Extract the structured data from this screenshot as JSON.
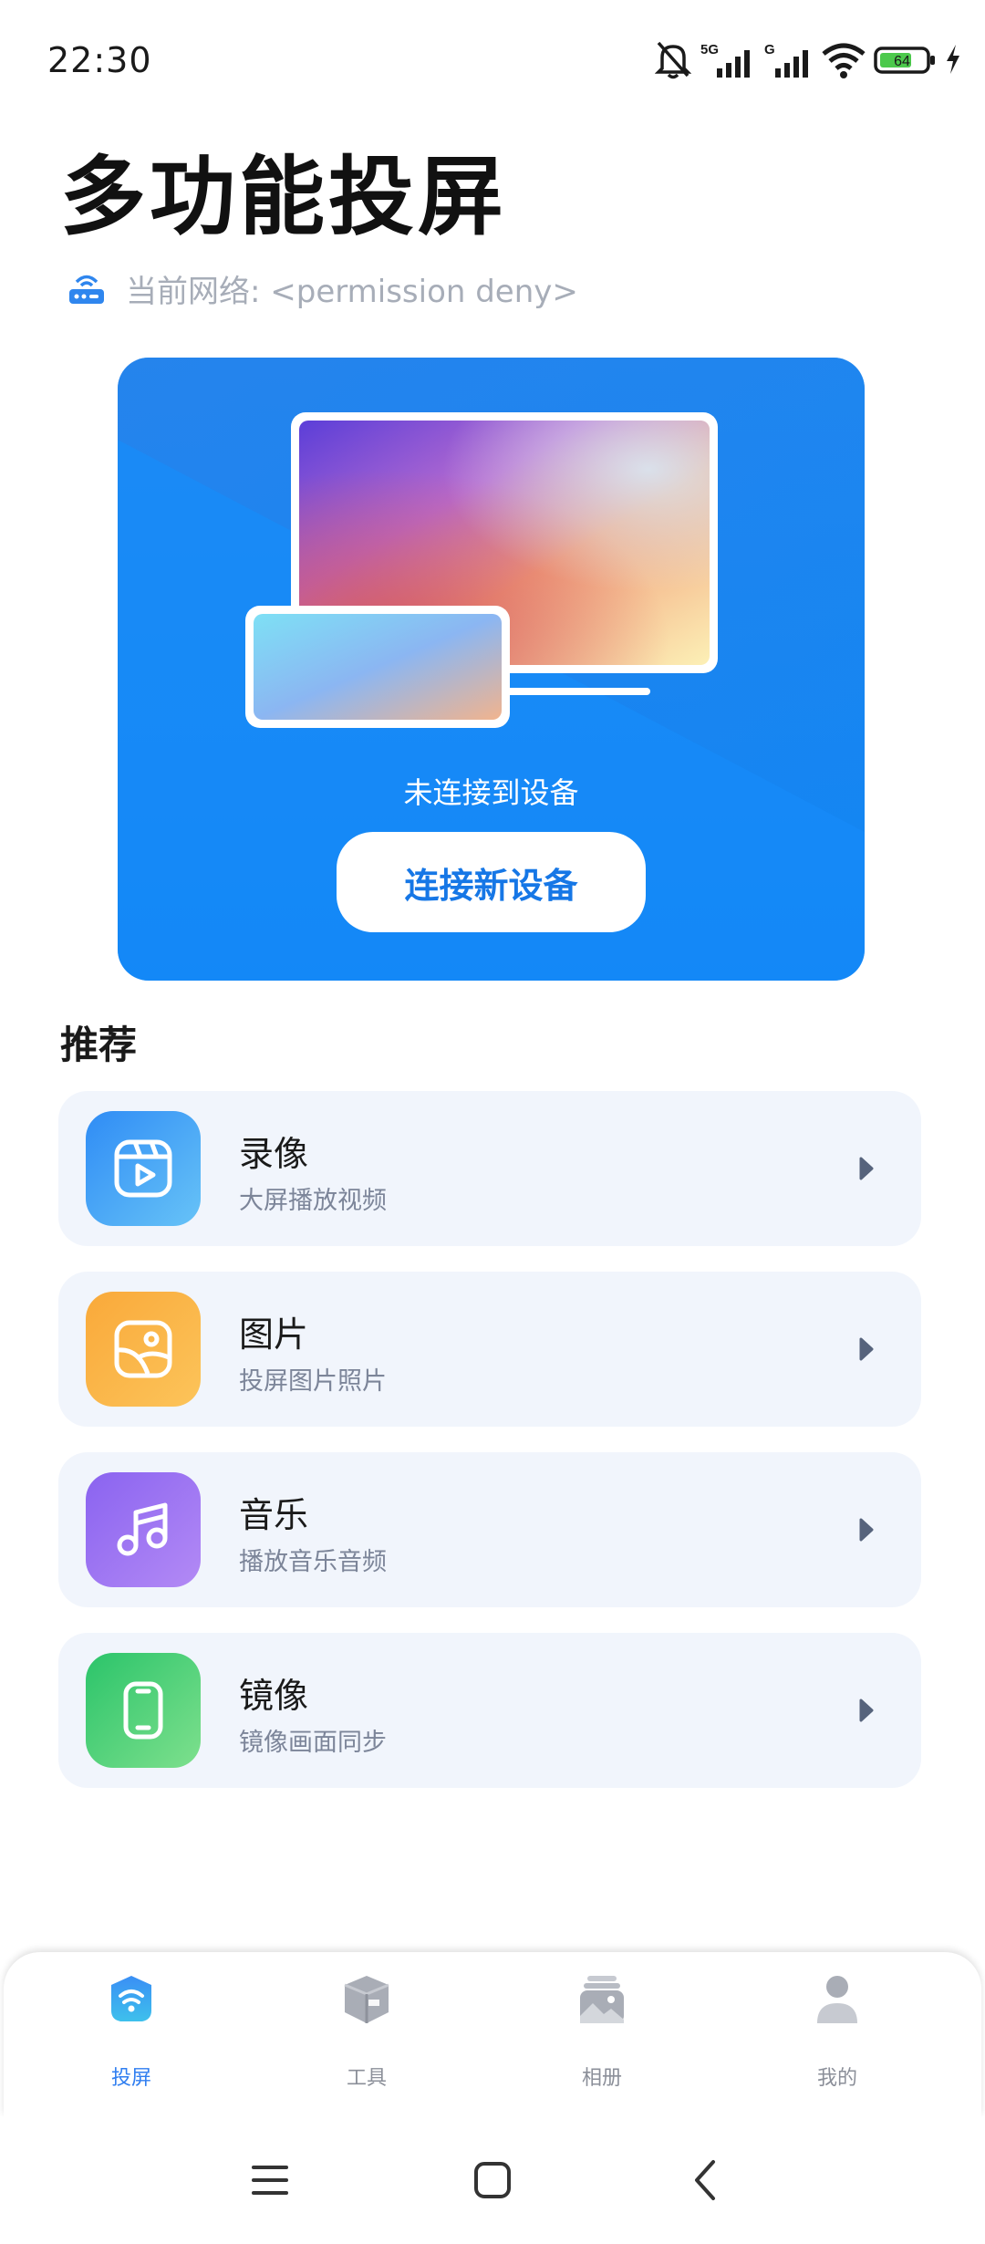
{
  "status_bar": {
    "time": "22:30",
    "battery": "64",
    "signal_1_label": "5G",
    "signal_2_label": "G",
    "icons": [
      "bell-muted-icon",
      "signal-5g-icon",
      "signal-g-icon",
      "wifi-icon",
      "battery-icon",
      "charging-icon"
    ]
  },
  "header": {
    "title": "多功能投屏",
    "network_label": "当前网络: <permission deny>",
    "network_icon": "router-icon"
  },
  "hero": {
    "status_text": "未连接到设备",
    "connect_button": "连接新设备",
    "background_color": "#1e8cf3"
  },
  "recommend": {
    "title": "推荐",
    "items": [
      {
        "title": "录像",
        "subtitle": "大屏播放视频",
        "icon": "video-clip-icon",
        "color_from": "#2f8cf5",
        "color_to": "#67c3f7"
      },
      {
        "title": "图片",
        "subtitle": "投屏图片照片",
        "icon": "photo-icon",
        "color_from": "#f9a93a",
        "color_to": "#fcc45a"
      },
      {
        "title": "音乐",
        "subtitle": "播放音乐音频",
        "icon": "music-note-icon",
        "color_from": "#8a63f0",
        "color_to": "#b38af5"
      },
      {
        "title": "镜像",
        "subtitle": "镜像画面同步",
        "icon": "phone-mirror-icon",
        "color_from": "#2bc46a",
        "color_to": "#7ee08d"
      }
    ]
  },
  "bottom_nav": {
    "items": [
      {
        "label": "投屏",
        "icon": "cast-wifi-icon",
        "active": true
      },
      {
        "label": "工具",
        "icon": "toolbox-icon",
        "active": false
      },
      {
        "label": "相册",
        "icon": "album-icon",
        "active": false
      },
      {
        "label": "我的",
        "icon": "user-icon",
        "active": false
      }
    ]
  },
  "system_nav": {
    "icons": [
      "menu-icon",
      "home-icon",
      "back-icon"
    ]
  },
  "colors": {
    "accent": "#1677e6",
    "card_bg": "#f1f5fc",
    "subtitle": "#7c8599"
  }
}
